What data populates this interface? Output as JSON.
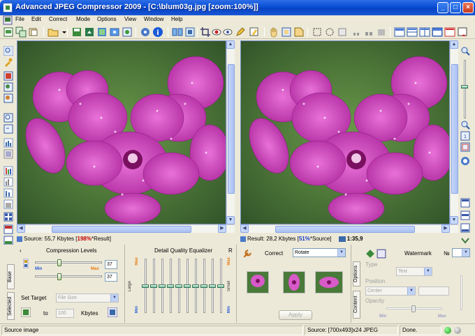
{
  "window": {
    "title": "Advanced JPEG Compressor 2009 - [C:\\blum03g.jpg  [zoom:100%]]"
  },
  "menu": [
    "File",
    "Edit",
    "Correct",
    "Mode",
    "Options",
    "View",
    "Window",
    "Help"
  ],
  "source_info": {
    "prefix": "Source: 55,7 Kbytes  [",
    "pct": "198%",
    "suffix": "*Result]"
  },
  "result_info": {
    "prefix": "Result: 28,2 Kbytes  [",
    "pct": "51%",
    "suffix": "*Source]"
  },
  "ratio": "1:35,9",
  "compression": {
    "title": "Compression Levels",
    "value1": "37",
    "value2": "37",
    "min_label": "Min",
    "max_label": "Max",
    "tab_base": "Base",
    "tab_selected": "Selected",
    "set_target_label": "Set Target",
    "target_option": "File Size",
    "to_label": "to",
    "target_value": "100",
    "unit_label": "Kbytes"
  },
  "equalizer": {
    "title": "Detail Quality Equalizer",
    "r_label": "R",
    "max_label": "Max",
    "min_label": "Min",
    "large_label": "Large",
    "small_label": "Small",
    "levels": [
      0.5,
      0.5,
      0.5,
      0.5,
      0.5,
      0.5,
      0.5,
      0.5,
      0.5,
      0.5
    ]
  },
  "correct": {
    "label": "Correct",
    "selected": "Rotate",
    "apply_label": "Apply"
  },
  "watermark": {
    "label": "Watermark",
    "number_label": "№",
    "type_label": "Type",
    "type_value": "Text",
    "position_label": "Position",
    "position_value": "Center",
    "opacity_label": "Opacity",
    "min_label": "Min",
    "max_label": "Max",
    "tab_options": "Options",
    "tab_content": "Content"
  },
  "status": {
    "left": "Source image",
    "middle": "Source: [700x493]x24 JPEG",
    "right": "Done."
  },
  "colors": {
    "accent": "#0a4fd6",
    "flower": "#c23cb0",
    "led_green": "#2ec02e"
  }
}
